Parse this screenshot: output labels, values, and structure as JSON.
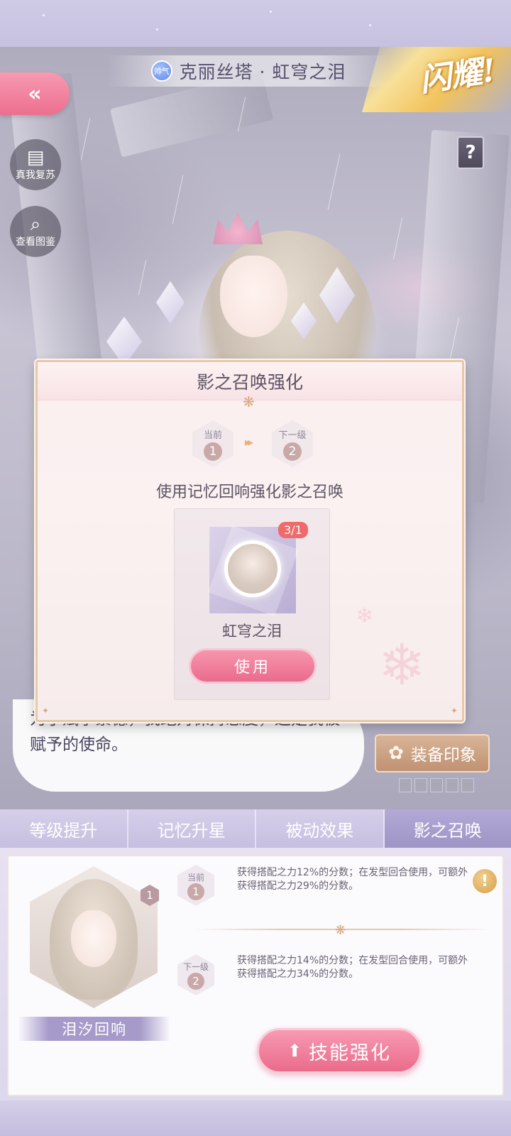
{
  "header": {
    "style_tag": "帅气",
    "title": "克丽丝塔 · 虹穹之泪",
    "shine_badge": "闪耀!"
  },
  "side_buttons": {
    "revive": "真我复苏",
    "gallery": "查看图鉴",
    "help": "?"
  },
  "scene": {
    "speech_line1": "为了赋予繁德，我绝对保持态度，这是我被",
    "speech_line2": "赋予的使命。",
    "equip_button": "装备印象"
  },
  "modal": {
    "title": "影之召唤强化",
    "current_label": "当前",
    "current_level": "1",
    "next_label": "下一级",
    "next_level": "2",
    "description": "使用记忆回响强化影之召唤",
    "item_count": "3/1",
    "item_name": "虹穹之泪",
    "use_button": "使用"
  },
  "tabs": [
    {
      "label": "等级提升"
    },
    {
      "label": "记忆升星"
    },
    {
      "label": "被动效果"
    },
    {
      "label": "影之召唤"
    }
  ],
  "active_tab": "影之召唤",
  "skill": {
    "level_badge": "1",
    "name": "泪汐回响",
    "current_label": "当前",
    "current_level": "1",
    "current_effect": "获得搭配之力12%的分数；在发型回合使用，可额外获得搭配之力29%的分数。",
    "next_label": "下一级",
    "next_level": "2",
    "next_effect": "获得搭配之力14%的分数；在发型回合使用，可额外获得搭配之力34%的分数。",
    "info_icon": "!",
    "upgrade_button": "技能强化"
  },
  "colors": {
    "accent_pink": "#ec6f8f",
    "tab_active": "#9f95c6",
    "badge_gold": "#d5a049"
  },
  "icons": {
    "back": "double-chevron-left-icon",
    "revive": "card-swap-icon",
    "gallery": "magnifier-icon",
    "help": "question-book-icon",
    "equip": "flower-icon",
    "upgrade": "up-arrow-icon",
    "info": "exclamation-icon"
  }
}
